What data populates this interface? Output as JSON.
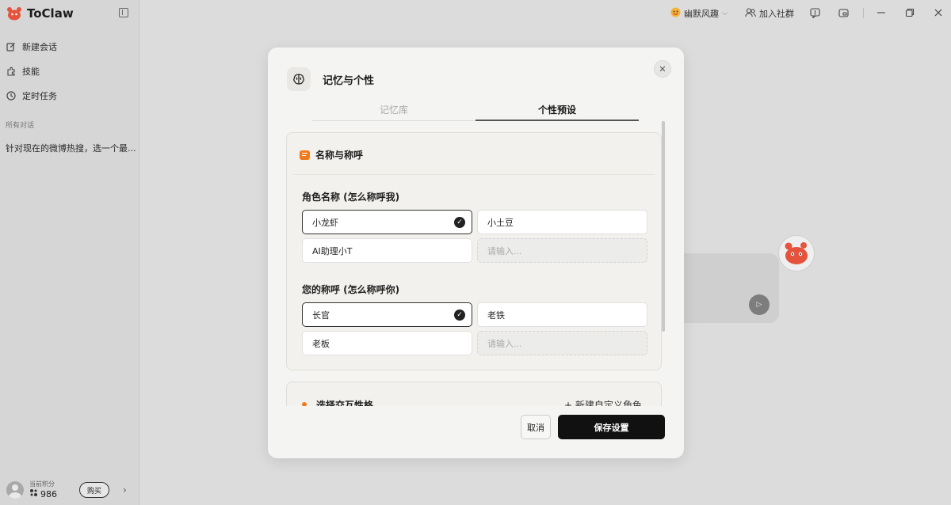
{
  "app": {
    "name": "ToClaw"
  },
  "sidebar": {
    "items": [
      {
        "label": "新建会话",
        "icon": "edit-icon"
      },
      {
        "label": "技能",
        "icon": "puzzle-icon"
      },
      {
        "label": "定时任务",
        "icon": "clock-icon"
      }
    ],
    "section_label": "所有对话",
    "history": [
      "针对现在的微博热搜，选一个最..."
    ],
    "footer": {
      "points_label": "当前积分",
      "points_value": "986",
      "buy_label": "购买"
    }
  },
  "topbar": {
    "persona": "幽默风趣",
    "join_community": "加入社群"
  },
  "modal": {
    "title": "记忆与个性",
    "tabs": [
      {
        "label": "记忆库",
        "active": false
      },
      {
        "label": "个性预设",
        "active": true
      }
    ],
    "section_title": "名称与称呼",
    "role_name_label": "角色名称 (怎么称呼我)",
    "role_name_options": [
      {
        "label": "小龙虾",
        "selected": true
      },
      {
        "label": "小土豆",
        "selected": false
      },
      {
        "label": "AI助理小T",
        "selected": false
      }
    ],
    "role_name_placeholder": "请输入...",
    "user_name_label": "您的称呼 (怎么称呼你)",
    "user_name_options": [
      {
        "label": "长官",
        "selected": true
      },
      {
        "label": "老铁",
        "selected": false
      },
      {
        "label": "老板",
        "selected": false
      }
    ],
    "user_name_placeholder": "请输入...",
    "next_section_title": "选择交互性格",
    "next_section_action": "+ 新建自定义角色",
    "cancel_label": "取消",
    "save_label": "保存设置"
  },
  "colors": {
    "accent": "#f07a1c",
    "primary_button": "#111111"
  }
}
